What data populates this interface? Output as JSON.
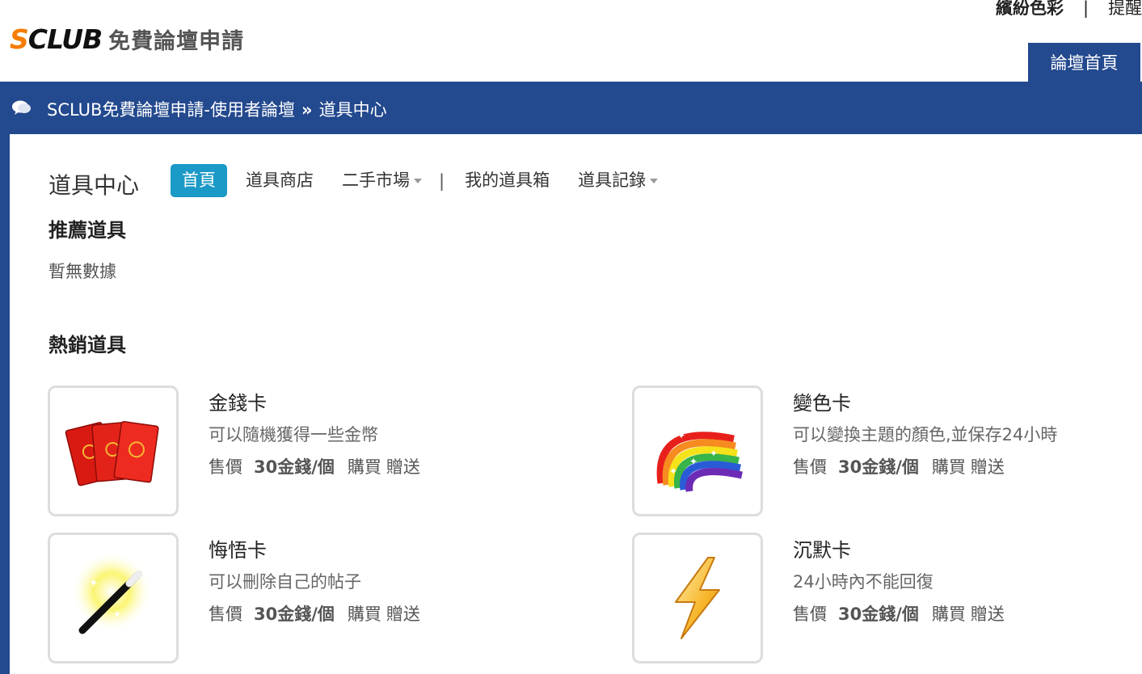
{
  "header": {
    "logo_s": "S",
    "logo_club": "CLUB",
    "logo_tagline": "免費論壇申請",
    "top_links": [
      "繽紛色彩",
      "提醒"
    ],
    "top_sep": "|",
    "forum_home_tab": "論壇首頁"
  },
  "breadcrumb": {
    "forum": "SCLUB免費論壇申請-使用者論壇",
    "arrow": "»",
    "current": "道具中心"
  },
  "page_title": "道具中心",
  "subnav": {
    "home": "首頁",
    "shop": "道具商店",
    "market": "二手市場",
    "separator": "|",
    "my_box": "我的道具箱",
    "log": "道具記錄"
  },
  "recommended": {
    "title": "推薦道具",
    "empty": "暫無數據"
  },
  "hot": {
    "title": "熱銷道具",
    "items": [
      {
        "name": "金錢卡",
        "desc": "可以隨機獲得一些金幣",
        "price_label": "售價",
        "price": "30金錢/個",
        "buy": "購買",
        "gift": "贈送",
        "icon": "red-envelope-icon"
      },
      {
        "name": "變色卡",
        "desc": "可以變換主題的顏色,並保存24小時",
        "price_label": "售價",
        "price": "30金錢/個",
        "buy": "購買",
        "gift": "贈送",
        "icon": "rainbow-icon"
      },
      {
        "name": "悔悟卡",
        "desc": "可以刪除自己的帖子",
        "price_label": "售價",
        "price": "30金錢/個",
        "buy": "購買",
        "gift": "贈送",
        "icon": "magic-wand-icon"
      },
      {
        "name": "沉默卡",
        "desc": "24小時內不能回復",
        "price_label": "售價",
        "price": "30金錢/個",
        "buy": "購買",
        "gift": "贈送",
        "icon": "lightning-icon"
      }
    ]
  },
  "colors": {
    "brand_blue": "#23498e",
    "active_tab": "#1b99c7",
    "logo_orange": "#f57c00"
  }
}
